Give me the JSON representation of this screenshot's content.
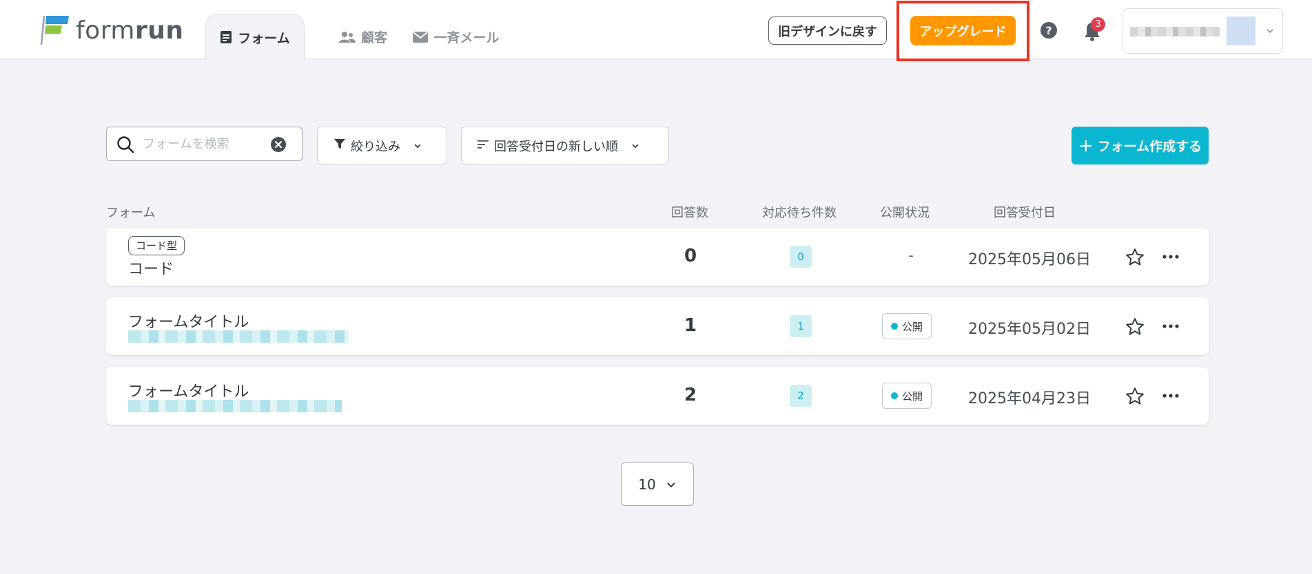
{
  "header": {
    "logo_text_light": "form",
    "logo_text_bold": "run",
    "tabs": [
      {
        "label": "フォーム",
        "icon": "document-icon",
        "active": true
      },
      {
        "label": "顧客",
        "icon": "users-icon",
        "active": false
      },
      {
        "label": "一斉メール",
        "icon": "mail-icon",
        "active": false
      }
    ],
    "old_design_label": "旧デザインに戻す",
    "upgrade_label": "アップグレード",
    "notification_count": "3",
    "accent_color": "#0bb7d0",
    "upgrade_color": "#ff9800"
  },
  "toolbar": {
    "search_placeholder": "フォームを検索",
    "filter_label": "絞り込み",
    "sort_label": "回答受付日の新しい順",
    "create_label": "フォーム作成する"
  },
  "table": {
    "headers": {
      "form": "フォーム",
      "count": "回答数",
      "pending": "対応待ち件数",
      "status": "公開状況",
      "date": "回答受付日"
    },
    "rows": [
      {
        "tag": "コード型",
        "title": "コード",
        "count": "0",
        "pending": "0",
        "status": "-",
        "date": "2025年05月06日"
      },
      {
        "tag": "",
        "title": "フォームタイトル",
        "count": "1",
        "pending": "1",
        "status": "公開",
        "date": "2025年05月02日"
      },
      {
        "tag": "",
        "title": "フォームタイトル",
        "count": "2",
        "pending": "2",
        "status": "公開",
        "date": "2025年04月23日"
      }
    ]
  },
  "pager": {
    "page_size": "10"
  }
}
